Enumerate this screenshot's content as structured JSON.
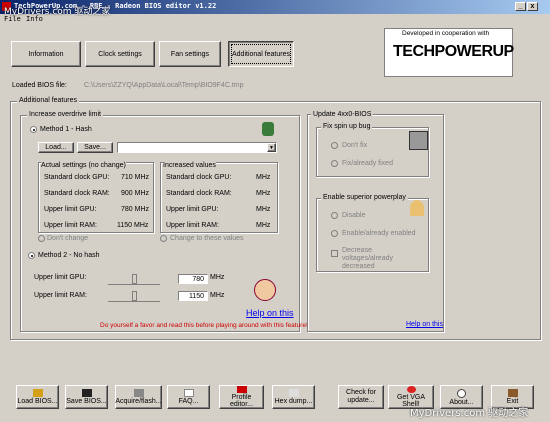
{
  "window": {
    "title": "TechPowerUp.com - RBE - Radeon BIOS editor v1.22"
  },
  "menu": [
    "File",
    "Info"
  ],
  "tabs": [
    "Information",
    "Clock settings",
    "Fan settings",
    "Additional features"
  ],
  "logo": {
    "caption": "Developed in cooperation with",
    "brand": "TECHPOWERUP"
  },
  "loaded_bios": {
    "label": "Loaded BIOS file:",
    "path": "C:\\Users\\ZZYQ\\AppData\\Local\\Temp\\BIO9F4C.tmp"
  },
  "additional": {
    "title": "Additional features",
    "overdrive": {
      "title": "Increase overdrive limit",
      "method1": "Method 1 - Hash",
      "load": "Load...",
      "save": "Save...",
      "actual": {
        "title": "Actual settings (no change)",
        "rows": [
          {
            "label": "Standard clock GPU:",
            "value": "710 MHz"
          },
          {
            "label": "Standard clock RAM:",
            "value": "900 MHz"
          },
          {
            "label": "Upper limit GPU:",
            "value": "780 MHz"
          },
          {
            "label": "Upper limit RAM:",
            "value": "1150 MHz"
          }
        ]
      },
      "increased": {
        "title": "Increased values",
        "rows": [
          {
            "label": "Standard clock GPU:",
            "value": "MHz"
          },
          {
            "label": "Standard clock RAM:",
            "value": "MHz"
          },
          {
            "label": "Upper limit GPU:",
            "value": "MHz"
          },
          {
            "label": "Upper limit RAM:",
            "value": "MHz"
          }
        ]
      },
      "dont_change": "Don't change",
      "change_to": "Change to these values",
      "method2": "Method 2 - No hash",
      "upper_gpu_label": "Upper limit GPU:",
      "upper_gpu_value": "780",
      "upper_ram_label": "Upper limit RAM:",
      "upper_ram_value": "1150",
      "unit": "MHz",
      "help": "Help on this",
      "warning": "Do yourself a favor and read this before playing around with this feature!"
    },
    "update": {
      "title": "Update 4xx0-BIOS",
      "fan_bug": {
        "title": "Fix spin up bug",
        "opt1": "Don't fix",
        "opt2": "Fix/already fixed"
      },
      "powerplay": {
        "title": "Enable superior powerplay",
        "opt1": "Disable",
        "opt2": "Enable/already enabled",
        "check": "Decrease voltages/already decreased"
      },
      "help": "Help on this"
    }
  },
  "bottom": [
    "Load BIOS...",
    "Save BIOS...",
    "Acquire/flash...",
    "FAQ...",
    "Profile editor...",
    "Hex dump...",
    "Check for update...",
    "Get VGA Shell!",
    "About...",
    "Exit"
  ],
  "watermarks": {
    "top": "MyDrivers.com 驱动之家",
    "bottom": "MyDrivers.com 驱动之家"
  }
}
